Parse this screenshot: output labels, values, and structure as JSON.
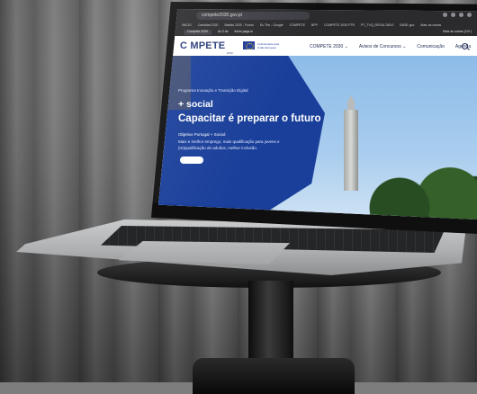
{
  "browser": {
    "url": "compete2030.gov.pt",
    "bookmarks": [
      "INÍCIO",
      "Candidat 2020",
      "Balcão 2020 - Fundo",
      "Eu The - Google",
      "COMPETE",
      "BPP",
      "COMPETE 2030 PTR",
      "PT_TVQ_RESULTADO",
      "BASE.gov",
      "Mais as outras"
    ],
    "tabs": [
      "Compete 2030",
      "ALO.ist",
      "Inicio pags.io"
    ],
    "profile": "Mais as outras (10+)"
  },
  "site": {
    "logo": "C MPETE",
    "logo_sub": "2030",
    "eu_text": "Cofinanciado pela União Europeia",
    "nav": [
      "COMPETE 2030 ⌄",
      "Avisos de Concursos ⌄",
      "Comunicação",
      "Agenda"
    ]
  },
  "hero": {
    "programa": "Programa Inovação e Transição Digital",
    "social": "+ social",
    "title": "Capacitar é preparar o futuro",
    "objetivo": "Objetivo Portugal + Social:",
    "desc_line1": "Mais e melhor emprego, mais qualificação para jovens e",
    "desc_line2": "(re)qualificação de adultos, melhor inclusão."
  },
  "colors": {
    "hero_blue": "#1a3f9a",
    "brand_navy": "#253a78",
    "sky": "#a9cdee"
  }
}
